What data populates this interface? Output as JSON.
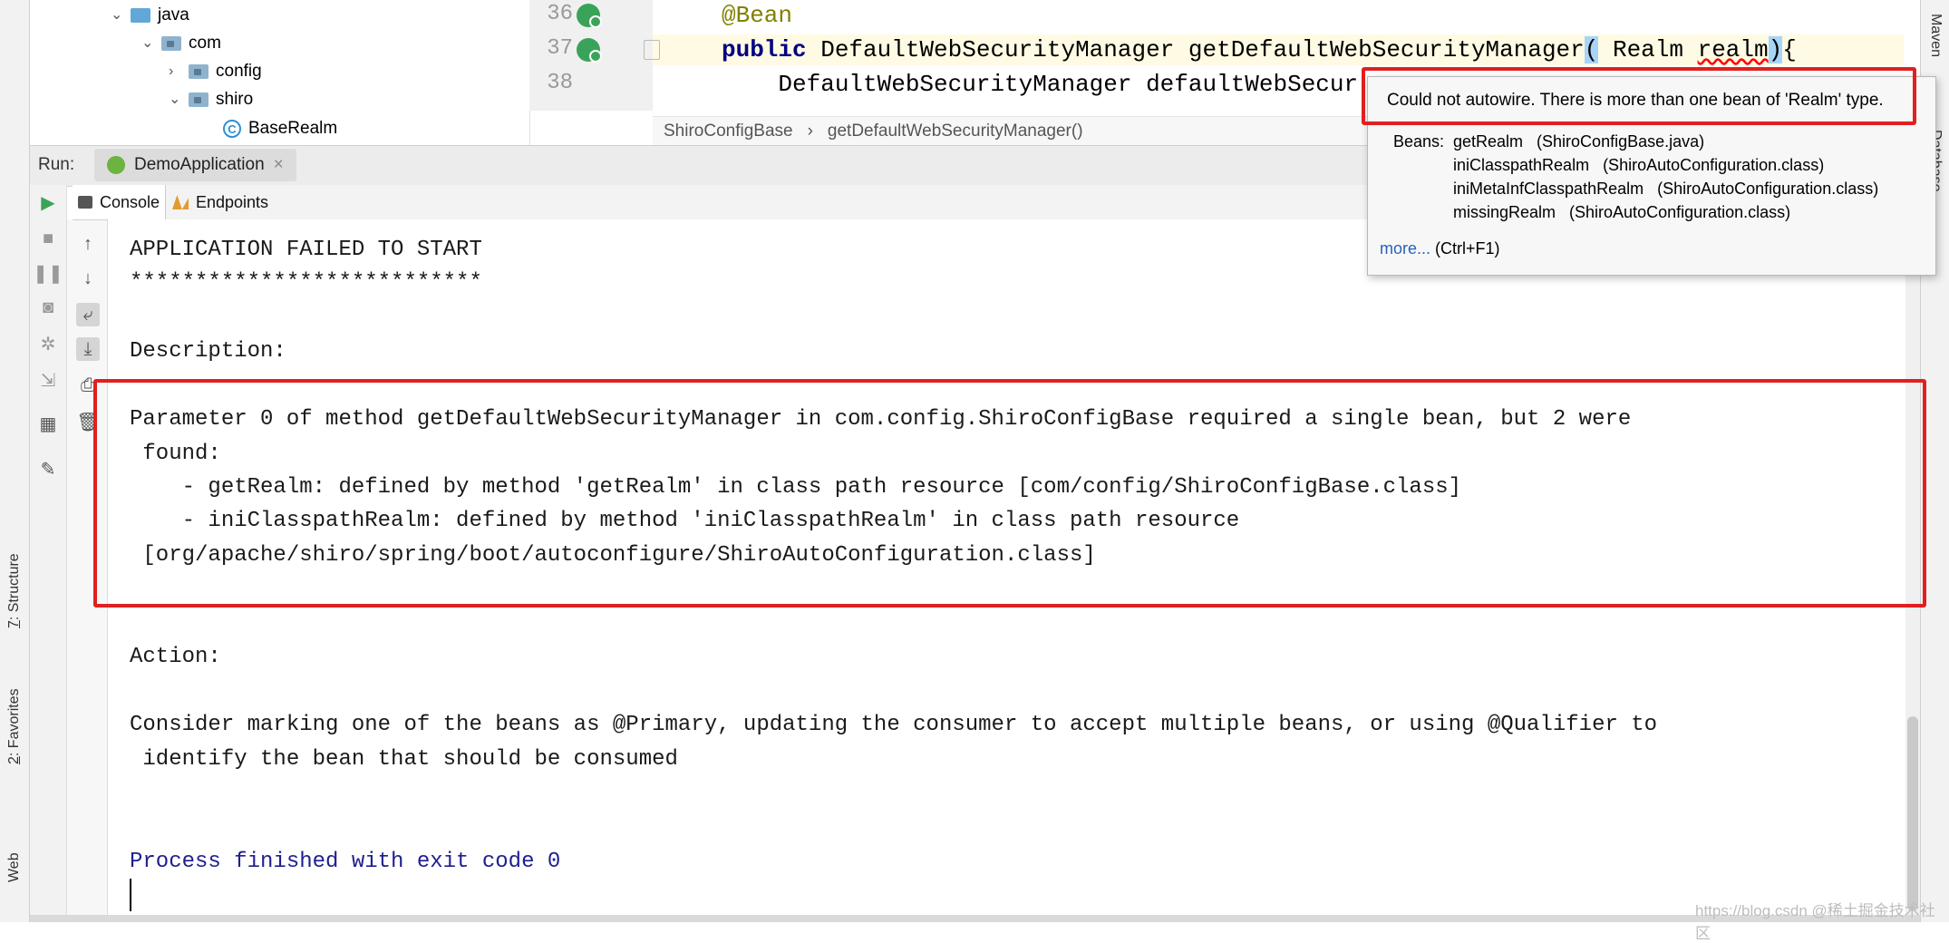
{
  "tree": {
    "items": [
      {
        "label": "java",
        "expanded": true,
        "icon": "folder-blue-icon"
      },
      {
        "label": "com",
        "expanded": true,
        "icon": "package-icon"
      },
      {
        "label": "config",
        "expanded": false,
        "icon": "package-icon"
      },
      {
        "label": "shiro",
        "expanded": true,
        "icon": "package-icon"
      },
      {
        "label": "BaseRealm",
        "icon": "class-icon"
      }
    ]
  },
  "editor": {
    "line_numbers": [
      "36",
      "37",
      "38"
    ],
    "lines": {
      "l36": "@Bean",
      "l37_kw": "public",
      "l37_a": " DefaultWebSecurityManager getDefaultWebSecurityManager",
      "l37_paren_open": "(",
      "l37_b": " Realm ",
      "l37_realm": "realm",
      "l37_paren_close": ")",
      "l37_brace": "{",
      "l38": "    DefaultWebSecurityManager defaultWebSecur"
    },
    "breadcrumbs": [
      "ShiroConfigBase",
      "getDefaultWebSecurityManager()"
    ]
  },
  "tooltip": {
    "message": "Could not autowire. There is more than one bean of 'Realm' type.",
    "beans_label": "Beans:",
    "beans": [
      "getRealm   (ShiroConfigBase.java)",
      "iniClasspathRealm   (ShiroAutoConfiguration.class)",
      "iniMetaInfClasspathRealm   (ShiroAutoConfiguration.class)",
      "missingRealm   (ShiroAutoConfiguration.class)"
    ],
    "more_link": "more...",
    "more_hint": "(Ctrl+F1)"
  },
  "run": {
    "label": "Run:",
    "config_name": "DemoApplication",
    "tabs": {
      "console": "Console",
      "endpoints": "Endpoints"
    }
  },
  "console": {
    "lines": [
      "APPLICATION FAILED TO START",
      "***************************",
      "Description:",
      "Parameter 0 of method getDefaultWebSecurityManager in com.config.ShiroConfigBase required a single bean, but 2 were",
      " found:",
      "    - getRealm: defined by method 'getRealm' in class path resource [com/config/ShiroConfigBase.class]",
      "    - iniClasspathRealm: defined by method 'iniClasspathRealm' in class path resource",
      " [org/apache/shiro/spring/boot/autoconfigure/ShiroAutoConfiguration.class]",
      "Action:",
      "Consider marking one of the beans as @Primary, updating the consumer to accept multiple beans, or using @Qualifier to",
      " identify the bean that should be consumed",
      "Process finished with exit code 0"
    ]
  },
  "side_tabs": {
    "left": [
      {
        "num": "7",
        "label": ": Structure"
      },
      {
        "num": "2",
        "label": ": Favorites"
      },
      {
        "num": "",
        "label": "Web"
      }
    ],
    "right": [
      "Maven",
      "Database"
    ]
  },
  "watermark": "https://blog.csdn  @稀土掘金技术社区",
  "colors": {
    "highlight_red": "#e02020",
    "keyword": "#000080",
    "annotation": "#808000",
    "link": "#2a62b8",
    "exit_text": "#1f1f8f"
  }
}
